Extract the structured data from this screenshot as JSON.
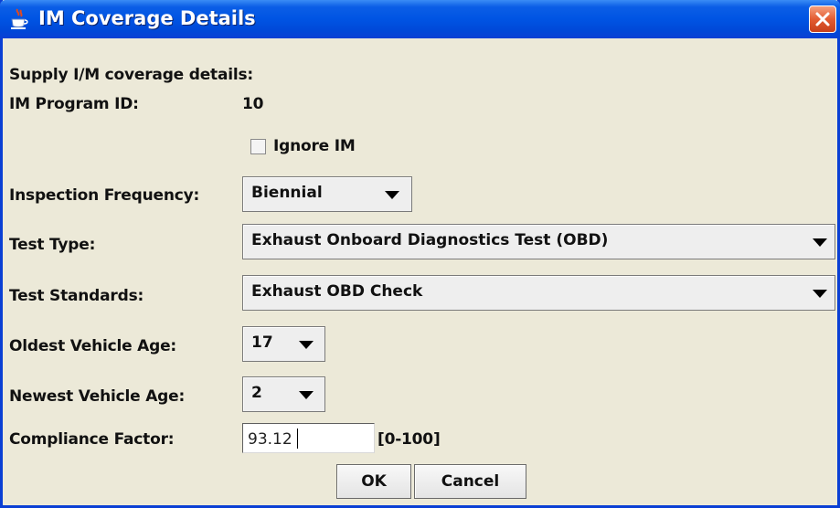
{
  "window": {
    "title": "IM Coverage Details"
  },
  "form": {
    "heading": "Supply I/M coverage details:",
    "program_id_label": "IM Program ID:",
    "program_id_value": "10",
    "ignore_im_label": "Ignore IM",
    "ignore_im_checked": false,
    "inspection_frequency_label": "Inspection Frequency:",
    "inspection_frequency_value": "Biennial",
    "test_type_label": "Test Type:",
    "test_type_value": "Exhaust Onboard Diagnostics Test (OBD)",
    "test_standards_label": "Test Standards:",
    "test_standards_value": "Exhaust OBD Check",
    "oldest_vehicle_age_label": "Oldest Vehicle Age:",
    "oldest_vehicle_age_value": "17",
    "newest_vehicle_age_label": "Newest Vehicle Age:",
    "newest_vehicle_age_value": "2",
    "compliance_factor_label": "Compliance Factor:",
    "compliance_factor_value": "93.12",
    "compliance_factor_range": "[0-100]"
  },
  "buttons": {
    "ok": "OK",
    "cancel": "Cancel"
  },
  "icons": {
    "app": "java-coffee-cup-icon",
    "close": "close-icon",
    "dropdown": "dropdown-arrow-icon"
  },
  "colors": {
    "titlebar": "#0054e3",
    "close_button": "#e35c32",
    "dialog_background": "#ece9d8"
  }
}
